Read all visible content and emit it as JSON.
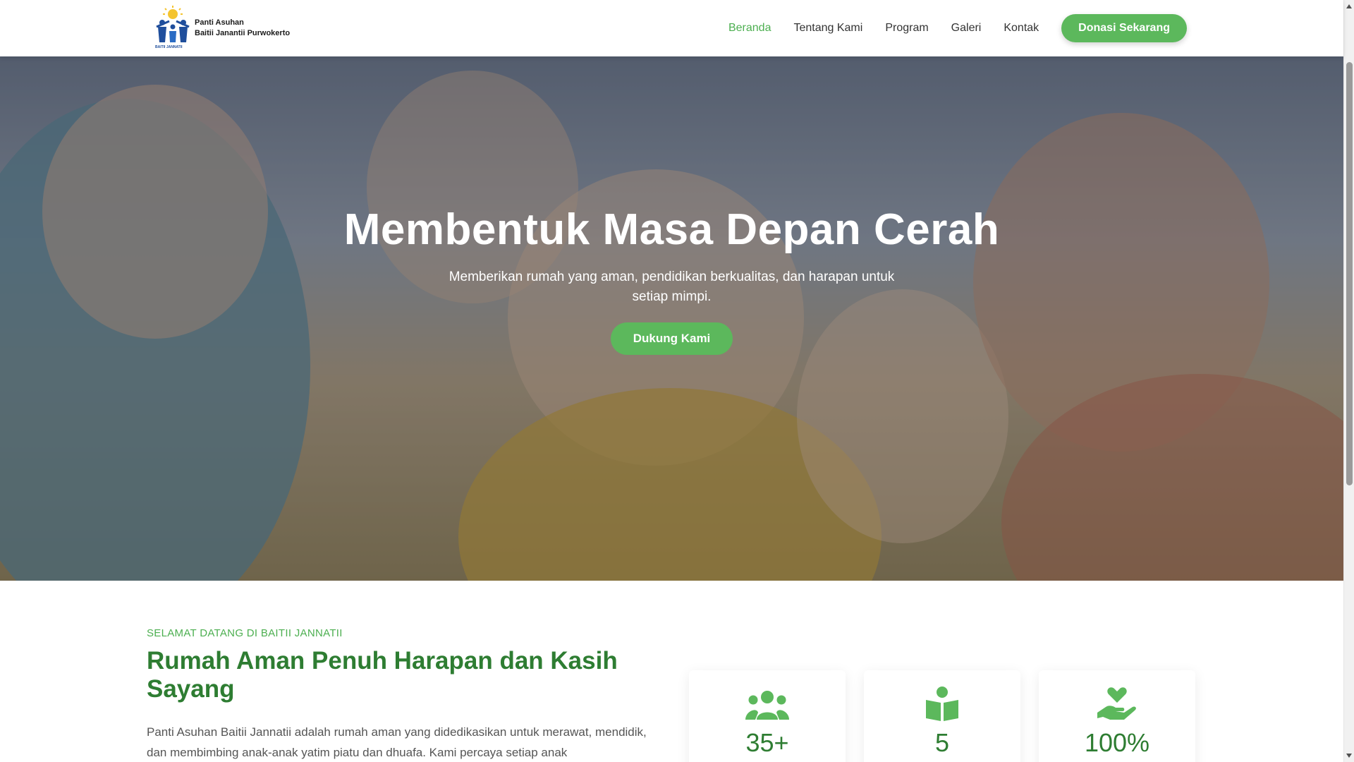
{
  "header": {
    "logo_line1": "Panti Asuhan",
    "logo_line2": "Baitii Janantii Purwokerto",
    "logo_small": "BAITII JANNATII",
    "nav": [
      "Beranda",
      "Tentang Kami",
      "Program",
      "Galeri",
      "Kontak"
    ],
    "active_nav": "Beranda",
    "donate_label": "Donasi Sekarang"
  },
  "hero": {
    "title": "Membentuk Masa Depan Cerah",
    "subtitle": "Memberikan rumah yang aman, pendidikan berkualitas, dan harapan untuk setiap mimpi.",
    "cta_label": "Dukung Kami"
  },
  "about": {
    "eyebrow": "SELAMAT DATANG DI BAITII JANNATII",
    "title": "Rumah Aman Penuh Harapan dan Kasih Sayang",
    "text": "Panti Asuhan Baitii Jannatii adalah rumah aman yang didedikasikan untuk merawat, mendidik, dan membimbing anak-anak yatim piatu dan dhuafa. Kami percaya setiap anak",
    "stats": [
      {
        "icon": "users-icon",
        "value": "35+"
      },
      {
        "icon": "book-reader-icon",
        "value": "5"
      },
      {
        "icon": "hand-heart-icon",
        "value": "100%"
      }
    ]
  },
  "colors": {
    "accent": "#5cb85c",
    "heading_green": "#2e7d32",
    "eyebrow_green": "#4caf50"
  }
}
